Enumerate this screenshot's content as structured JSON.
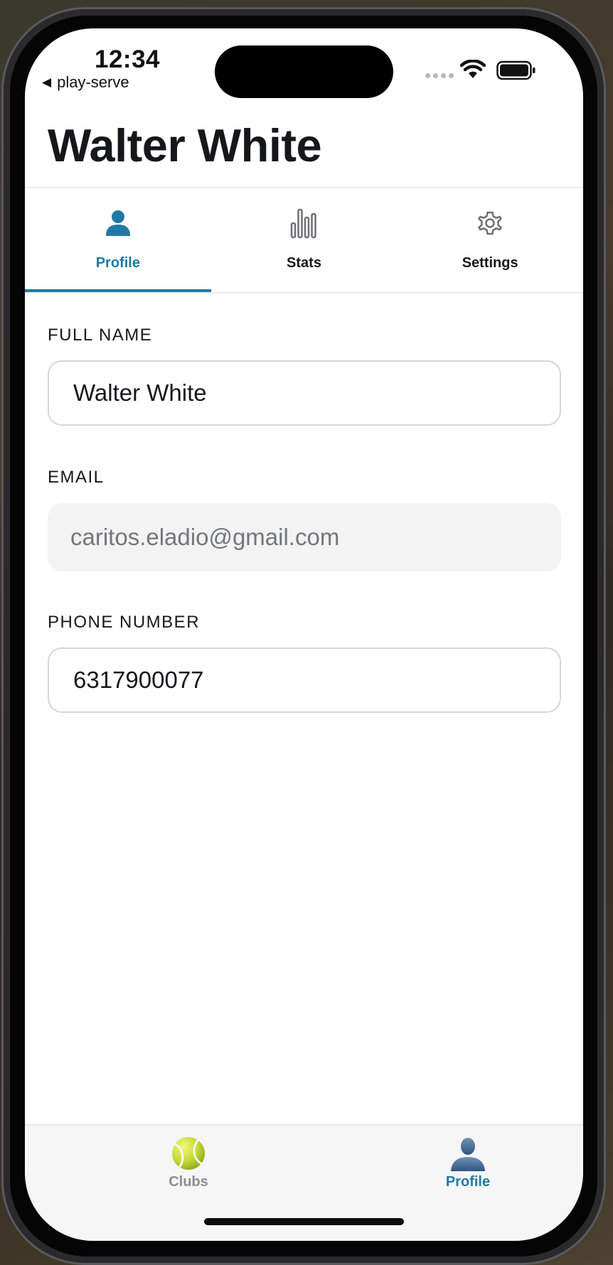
{
  "status_bar": {
    "time": "12:34",
    "back_app": "play-serve"
  },
  "header": {
    "title": "Walter White"
  },
  "tabs": [
    {
      "label": "Profile",
      "icon": "person-icon",
      "active": true
    },
    {
      "label": "Stats",
      "icon": "bar-chart-icon",
      "active": false
    },
    {
      "label": "Settings",
      "icon": "gear-icon",
      "active": false
    }
  ],
  "form": {
    "full_name": {
      "label": "FULL NAME",
      "value": "Walter White"
    },
    "email": {
      "label": "EMAIL",
      "value": "caritos.eladio@gmail.com"
    },
    "phone": {
      "label": "PHONE NUMBER",
      "value": "6317900077"
    }
  },
  "bottom_nav": [
    {
      "label": "Clubs",
      "icon": "tennis-ball-icon",
      "active": false
    },
    {
      "label": "Profile",
      "icon": "user-silhouette-icon",
      "active": true
    }
  ],
  "colors": {
    "accent": "#1f7aa3",
    "text": "#15181b",
    "muted": "#8a8d90"
  }
}
